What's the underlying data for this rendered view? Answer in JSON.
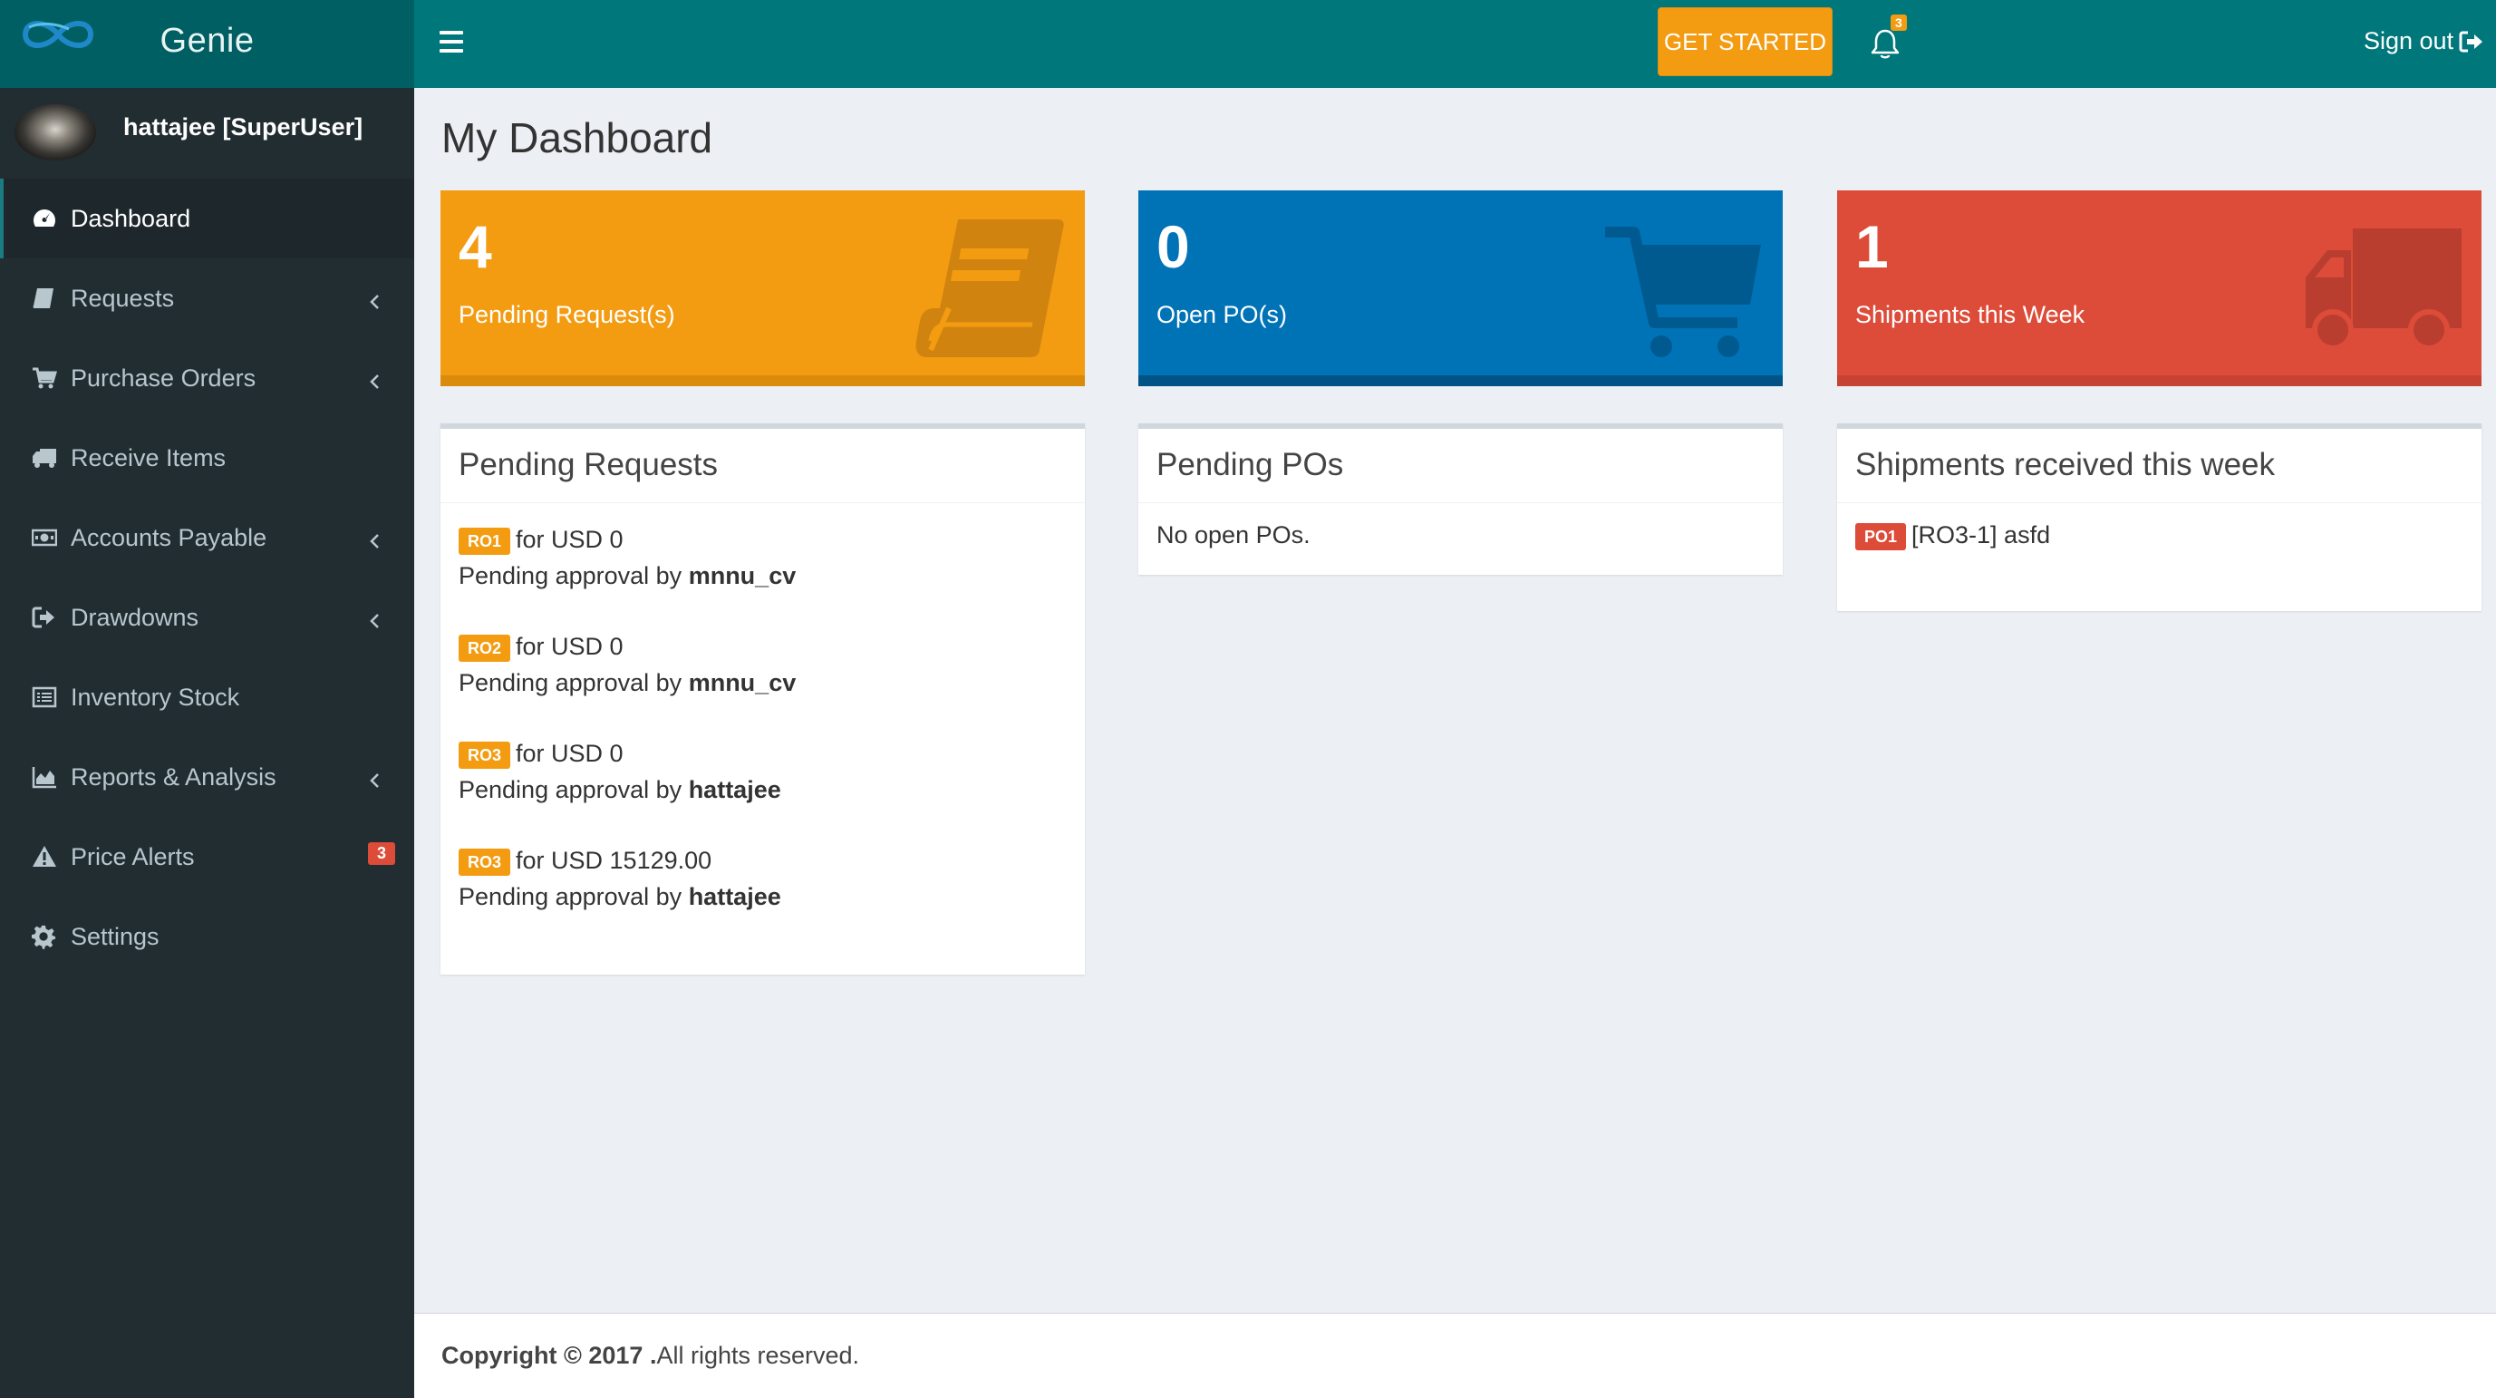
{
  "app": {
    "name": "Genie"
  },
  "colors": {
    "header_dark": "#005f62",
    "header": "#00777b",
    "sidebar": "#222d32",
    "yellow": "#f39c12",
    "blue": "#0073b7",
    "red": "#dd4b39"
  },
  "topbar": {
    "get_started_label": "GET STARTED",
    "notification_count": "3",
    "signout_label": "Sign out"
  },
  "user": {
    "name": "hattajee [SuperUser]"
  },
  "sidebar": {
    "items": [
      {
        "label": "Dashboard",
        "icon": "dashboard-icon",
        "active": true
      },
      {
        "label": "Requests",
        "icon": "book-icon",
        "expandable": true
      },
      {
        "label": "Purchase Orders",
        "icon": "cart-icon",
        "expandable": true
      },
      {
        "label": "Receive Items",
        "icon": "truck-icon"
      },
      {
        "label": "Accounts Payable",
        "icon": "money-icon",
        "expandable": true
      },
      {
        "label": "Drawdowns",
        "icon": "sign-out-icon",
        "expandable": true
      },
      {
        "label": "Inventory Stock",
        "icon": "list-icon"
      },
      {
        "label": "Reports & Analysis",
        "icon": "area-chart-icon",
        "expandable": true
      },
      {
        "label": "Price Alerts",
        "icon": "warning-icon",
        "badge": "3"
      },
      {
        "label": "Settings",
        "icon": "gear-icon"
      }
    ]
  },
  "page": {
    "title": "My Dashboard"
  },
  "info_boxes": [
    {
      "value": "4",
      "label": "Pending Request(s)",
      "icon": "book-icon"
    },
    {
      "value": "0",
      "label": "Open PO(s)",
      "icon": "cart-icon"
    },
    {
      "value": "1",
      "label": "Shipments this Week",
      "icon": "truck-icon"
    }
  ],
  "pending_requests": {
    "title": "Pending Requests",
    "items": [
      {
        "tag": "RO1",
        "text": "for USD 0",
        "approval_prefix": "Pending approval by ",
        "approver": "mnnu_cv"
      },
      {
        "tag": "RO2",
        "text": "for USD 0",
        "approval_prefix": "Pending approval by ",
        "approver": "mnnu_cv"
      },
      {
        "tag": "RO3",
        "text": "for USD 0",
        "approval_prefix": "Pending approval by ",
        "approver": "hattajee"
      },
      {
        "tag": "RO3",
        "text": "for USD 15129.00",
        "approval_prefix": "Pending approval by ",
        "approver": "hattajee"
      }
    ]
  },
  "pending_pos": {
    "title": "Pending POs",
    "empty_text": "No open POs."
  },
  "shipments": {
    "title": "Shipments received this week",
    "items": [
      {
        "tag": "PO1",
        "text": "[RO3-1] asfd"
      }
    ]
  },
  "footer": {
    "copyright": "Copyright © 2017 .",
    "rights": " All rights reserved."
  }
}
